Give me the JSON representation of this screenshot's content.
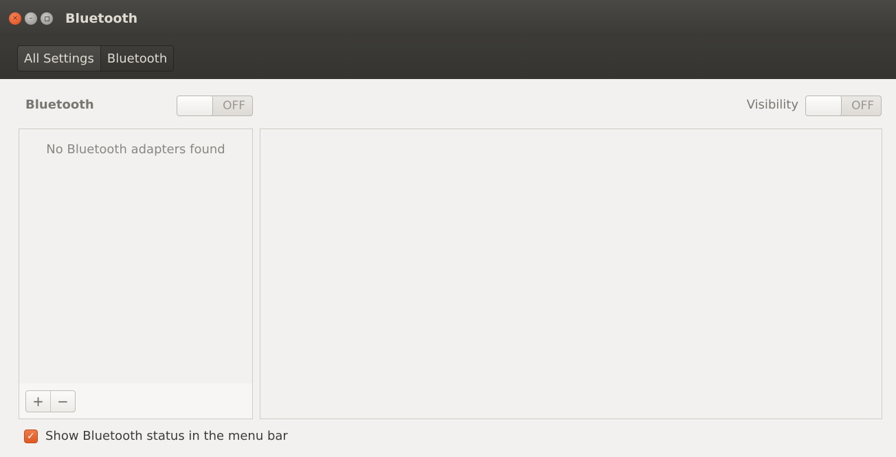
{
  "window": {
    "title": "Bluetooth",
    "controls": {
      "close_glyph": "×",
      "minimize_glyph": "–"
    }
  },
  "breadcrumb": {
    "items": [
      {
        "label": "All Settings"
      },
      {
        "label": "Bluetooth"
      }
    ]
  },
  "header": {
    "bluetooth_label": "Bluetooth",
    "bluetooth_switch_state": "OFF",
    "visibility_label": "Visibility",
    "visibility_switch_state": "OFF"
  },
  "adapters": {
    "empty_message": "No Bluetooth adapters found",
    "add_label": "+",
    "remove_label": "−"
  },
  "status": {
    "show_in_menu_bar_label": "Show Bluetooth status in the menu bar",
    "show_in_menu_bar_checked": true,
    "check_glyph": "✓"
  },
  "colors": {
    "accent": "#dd4814",
    "titlebar": "#3c3b37",
    "background": "#f2f1f0"
  }
}
